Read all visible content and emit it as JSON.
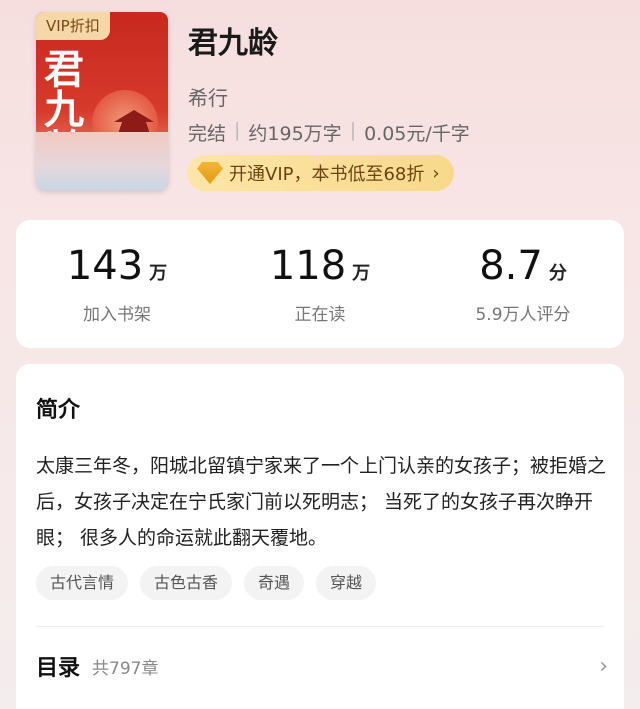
{
  "book": {
    "vip_badge": "VIP折扣",
    "title": "君九龄",
    "author": "希行",
    "status": "完结",
    "words": "约195万字",
    "price": "0.05元/千字",
    "cover_calligraphy": "君九龄",
    "vip_offer": "开通VIP，本书低至68折"
  },
  "stats": [
    {
      "value": "143",
      "unit": "万",
      "label": "加入书架"
    },
    {
      "value": "118",
      "unit": "万",
      "label": "正在读"
    },
    {
      "value": "8.7",
      "unit": "分",
      "label": "5.9万人评分"
    }
  ],
  "intro": {
    "heading": "简介",
    "text": "太康三年冬，阳城北留镇宁家来了一个上门认亲的女孩子；被拒婚之后，女孩子决定在宁氏家门前以死明志； 当死了的女孩子再次睁开眼； 很多人的命运就此翻天覆地。",
    "tags": [
      "古代言情",
      "古色古香",
      "奇遇",
      "穿越"
    ]
  },
  "toc": {
    "heading": "目录",
    "count": "共797章"
  },
  "icons": {
    "vip_gem": "diamond-icon",
    "chevron": "chevron-right-icon"
  },
  "colors": {
    "vip_pill": "#f8d98b",
    "vip_badge": "#f6d7a7",
    "cover_red": "#c8281f"
  }
}
